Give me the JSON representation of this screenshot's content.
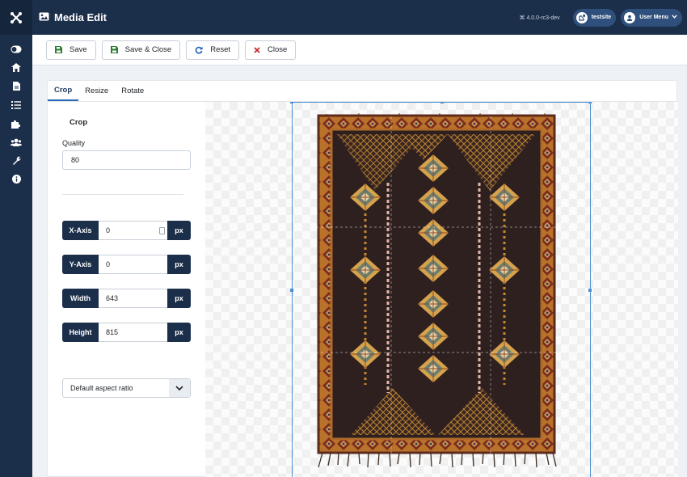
{
  "header": {
    "title": "Media Edit",
    "version": "⌘ 4.0.0-rc3-dev",
    "site_label": "testsite",
    "user_menu_label": "User Menu"
  },
  "toolbar": {
    "save_label": "Save",
    "save_close_label": "Save & Close",
    "reset_label": "Reset",
    "close_label": "Close"
  },
  "tabs": [
    "Crop",
    "Resize",
    "Rotate"
  ],
  "crop": {
    "heading": "Crop",
    "quality_label": "Quality",
    "quality_value": "80",
    "x_axis_label": "X-Axis",
    "x_axis_value": "0",
    "y_axis_label": "Y-Axis",
    "y_axis_value": "0",
    "width_label": "Width",
    "width_value": "643",
    "height_label": "Height",
    "height_value": "815",
    "unit": "px",
    "aspect_ratio": "Default aspect ratio"
  },
  "colors": {
    "sidebar": "#1c2f4a",
    "accent": "#2a69b8",
    "crop_outline": "#4d8fd0",
    "save_icon": "#2e7d32",
    "reset_icon": "#2a69b8",
    "close_icon": "#c62828"
  },
  "icons": {
    "logo": "joomla-icon",
    "sidebar": [
      "toggle-icon",
      "home-icon",
      "file-icon",
      "list-icon",
      "puzzle-icon",
      "users-icon",
      "wrench-icon",
      "info-icon"
    ]
  }
}
